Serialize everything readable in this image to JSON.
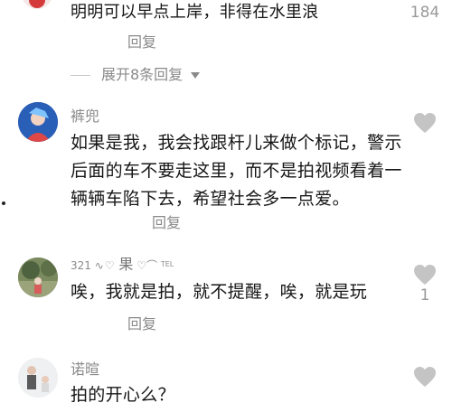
{
  "colors": {
    "text_primary": "#161616",
    "text_secondary": "#8a8a8a",
    "heart_gray": "#c4c4c4"
  },
  "thread": {
    "reply_top": {
      "text": "明明可以早点上岸，非得在水里浪",
      "reply_label": "回复",
      "like_count": "184"
    },
    "expand_label": "展开8条回复"
  },
  "comments": [
    {
      "username": "裤兜",
      "text_lines": [
        "如果是我，我会找跟杆儿来做个标记，警示",
        "后面的车不要走这里，而不是拍视频看着一",
        "辆辆车陷下去，希望社会多一点爱。"
      ],
      "reply_label": "回复",
      "like_count": ""
    },
    {
      "username": "321",
      "username_decor": "果",
      "username_suffix": "TEL",
      "text_lines": [
        "唉，我就是拍，就不提醒，唉，就是玩"
      ],
      "reply_label": "回复",
      "like_count": "1"
    },
    {
      "username": "诺暄",
      "text_lines": [
        "拍的开心么？"
      ],
      "reply_label": "",
      "like_count": ""
    }
  ]
}
